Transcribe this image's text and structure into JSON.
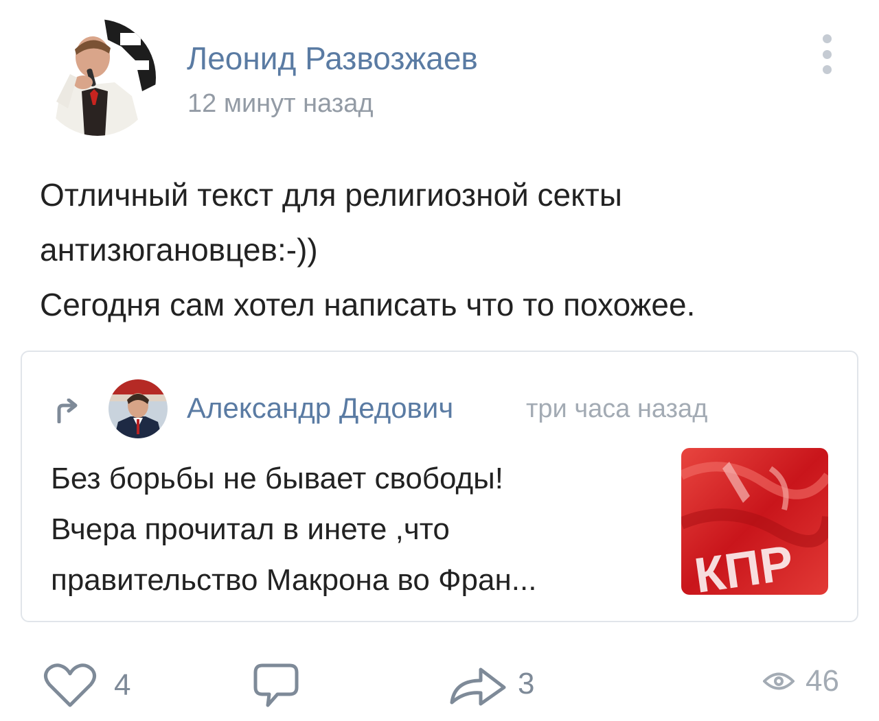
{
  "post": {
    "author": "Леонид Развозжаев",
    "time": "12 минут назад",
    "text_lines": [
      "Отличный текст для религиозной секты",
      "антизюгановцев:-))",
      "Сегодня сам хотел написать что то похожее."
    ]
  },
  "repost": {
    "author": "Александр Дедович",
    "time": "три часа назад",
    "text_lines": [
      "Без борьбы не бывает свободы!",
      "Вчера прочитал в инете ,что",
      "правительство Макрона во Фран..."
    ],
    "thumbnail_caption": "КПР"
  },
  "actions": {
    "likes": "4",
    "reposts": "3",
    "views": "46"
  },
  "icons": {
    "more": "more-vertical-icon",
    "repost_marker": "repost-arrow-icon",
    "like": "heart-icon",
    "comment": "comment-bubble-icon",
    "share": "share-arrow-icon",
    "views": "eye-icon"
  },
  "colors": {
    "link": "#5a7ba3",
    "muted": "#939ba5",
    "icon": "#7e8a98",
    "text": "#222222"
  }
}
